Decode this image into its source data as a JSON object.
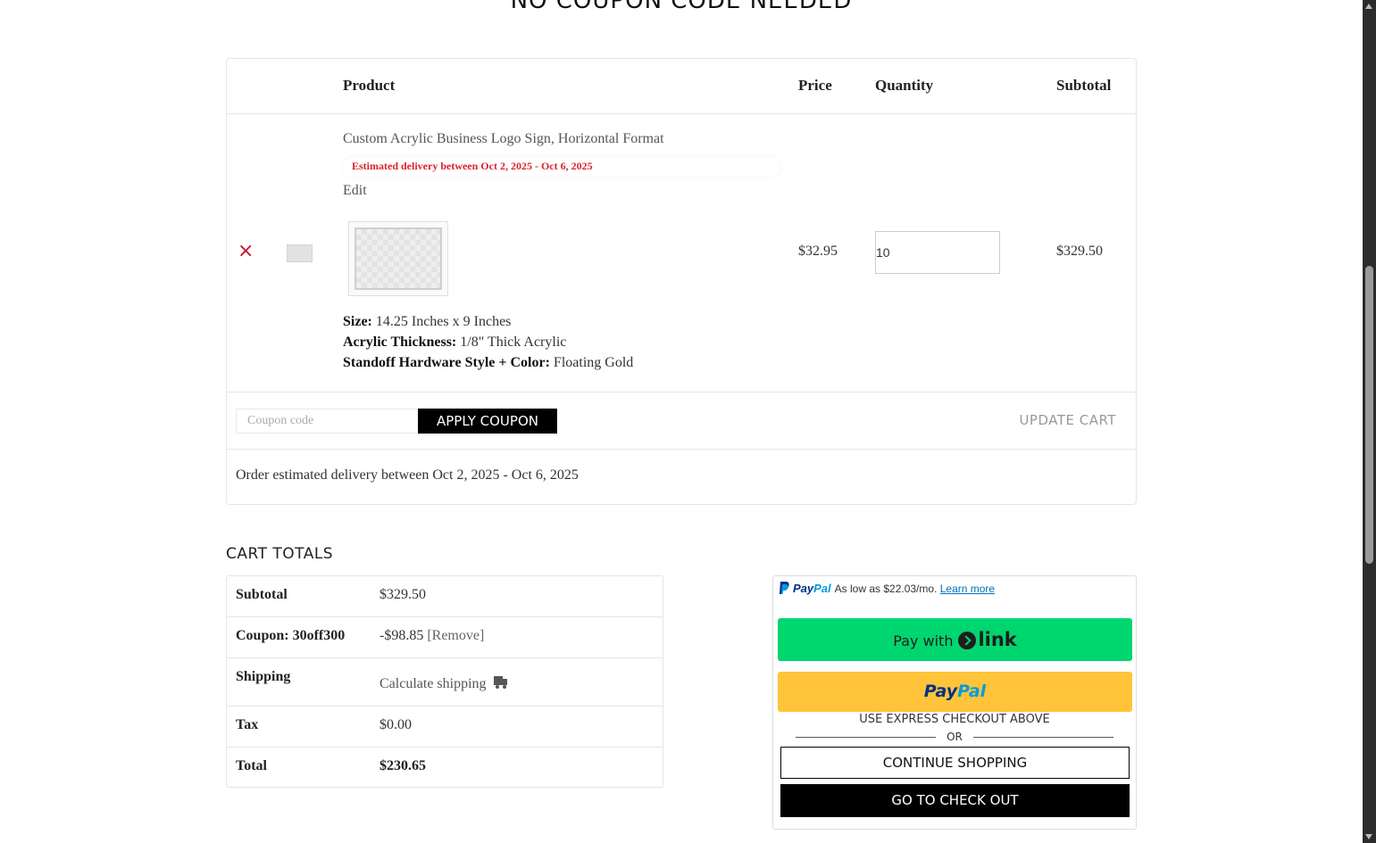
{
  "heading": "NO COUPON CODE NEEDED",
  "cart": {
    "headers": {
      "product": "Product",
      "price": "Price",
      "quantity": "Quantity",
      "subtotal": "Subtotal"
    },
    "item": {
      "remove_glyph": "×",
      "name": "Custom Acrylic Business Logo Sign, Horizontal Format",
      "delivery": "Estimated delivery between Oct 2, 2025 - Oct 6, 2025",
      "edit": "Edit",
      "attrs": [
        {
          "label": "Size:",
          "value": "14.25 Inches x 9 Inches"
        },
        {
          "label": "Acrylic Thickness:",
          "value": "1/8\" Thick Acrylic"
        },
        {
          "label": "Standoff Hardware Style + Color:",
          "value": "Floating Gold"
        }
      ],
      "price": "$32.95",
      "quantity": "10",
      "subtotal": "$329.50"
    },
    "coupon_placeholder": "Coupon code",
    "apply_coupon": "APPLY COUPON",
    "update_cart": "UPDATE CART",
    "order_delivery": "Order estimated delivery between Oct 2, 2025 - Oct 6, 2025"
  },
  "totals": {
    "title": "CART TOTALS",
    "subtotal_label": "Subtotal",
    "subtotal_value": "$329.50",
    "coupon_label": "Coupon: 30off300",
    "coupon_value": "-$98.85",
    "coupon_remove": "[Remove]",
    "shipping_label": "Shipping",
    "shipping_value": "Calculate shipping",
    "shipping_icon": "truck-icon",
    "tax_label": "Tax",
    "tax_value": "$0.00",
    "total_label": "Total",
    "total_value": "$230.65"
  },
  "checkout": {
    "paypal_msg_logo_1": "Pay",
    "paypal_msg_logo_2": "Pal",
    "paypal_msg": "As low as $22.03/mo.",
    "paypal_learn": "Learn more",
    "link_pay_with": "Pay with",
    "link_word": "link",
    "paypal_btn_1": "Pay",
    "paypal_btn_2": "Pal",
    "express_text": "USE EXPRESS CHECKOUT ABOVE",
    "or_text": "OR",
    "continue_shopping": "CONTINUE SHOPPING",
    "go_to_checkout": "GO TO CHECK OUT",
    "colors": {
      "link_green": "#00d66f",
      "paypal_yellow": "#ffc439",
      "paypal_blue": "#003087",
      "paypal_light_blue": "#009cde",
      "remove_red": "#c8102e",
      "delivery_red": "#d8232a"
    }
  }
}
